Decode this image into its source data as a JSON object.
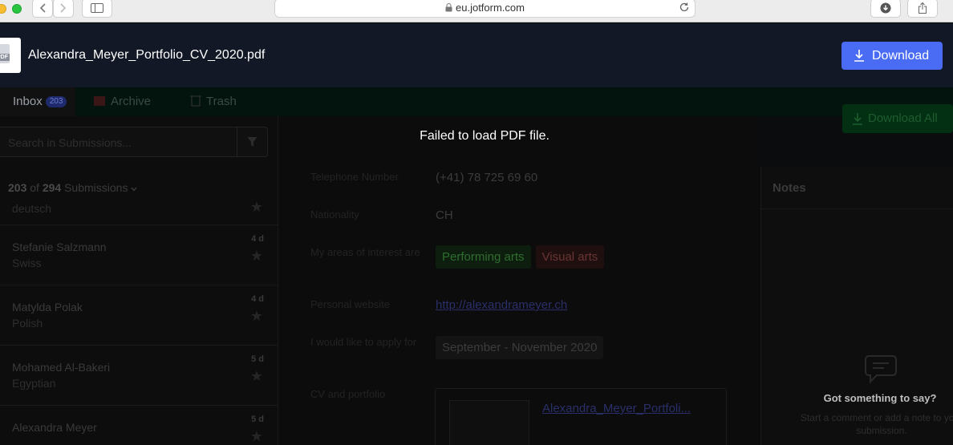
{
  "browser": {
    "url": "eu.jotform.com"
  },
  "viewer": {
    "file_name": "Alexandra_Meyer_Portfolio_CV_2020.pdf",
    "file_badge": "PDF",
    "download_label": "Download",
    "error_message": "Failed to load PDF file."
  },
  "tabs": [
    {
      "label": "Inbox",
      "count": "203"
    },
    {
      "label": "Archive"
    },
    {
      "label": "Trash"
    }
  ],
  "sidebar": {
    "search_placeholder": "Search in Submissions...",
    "count_shown": "203",
    "count_of": "of",
    "count_total": "294",
    "count_suffix": "Submissions",
    "partial_item_sub": "deutsch",
    "items": [
      {
        "name": "Stefanie Salzmann",
        "sub": "Swiss",
        "age": "4 d"
      },
      {
        "name": "Matylda Polak",
        "sub": "Polish",
        "age": "4 d"
      },
      {
        "name": "Mohamed Al-Bakeri",
        "sub": "Egyptian",
        "age": "5 d"
      },
      {
        "name": "Alexandra Meyer",
        "sub": "",
        "age": "5 d"
      }
    ]
  },
  "detail": {
    "download_all_label": "Download All",
    "fields": {
      "phone_label": "Telephone Number",
      "phone_value": "(+41) 78 725 69 60",
      "nationality_label": "Nationality",
      "nationality_value": "CH",
      "interest_label": "My areas of interest are",
      "interest_tags": [
        "Performing arts",
        "Visual arts"
      ],
      "website_label": "Personal website",
      "website_value": "http://alexandrameyer.ch",
      "apply_label": "I would like to apply for",
      "apply_value": "September - November 2020",
      "cv_label": "CV and portfolio",
      "cv_file": "Alexandra_Meyer_Portfoli..."
    }
  },
  "notes": {
    "title": "Notes",
    "question": "Got something to say?",
    "sub": "Start a comment or add a note to your submission."
  },
  "colors": {
    "download_button": "#4a6cf5",
    "viewer_bar": "#131926",
    "overlay": "#000000"
  }
}
